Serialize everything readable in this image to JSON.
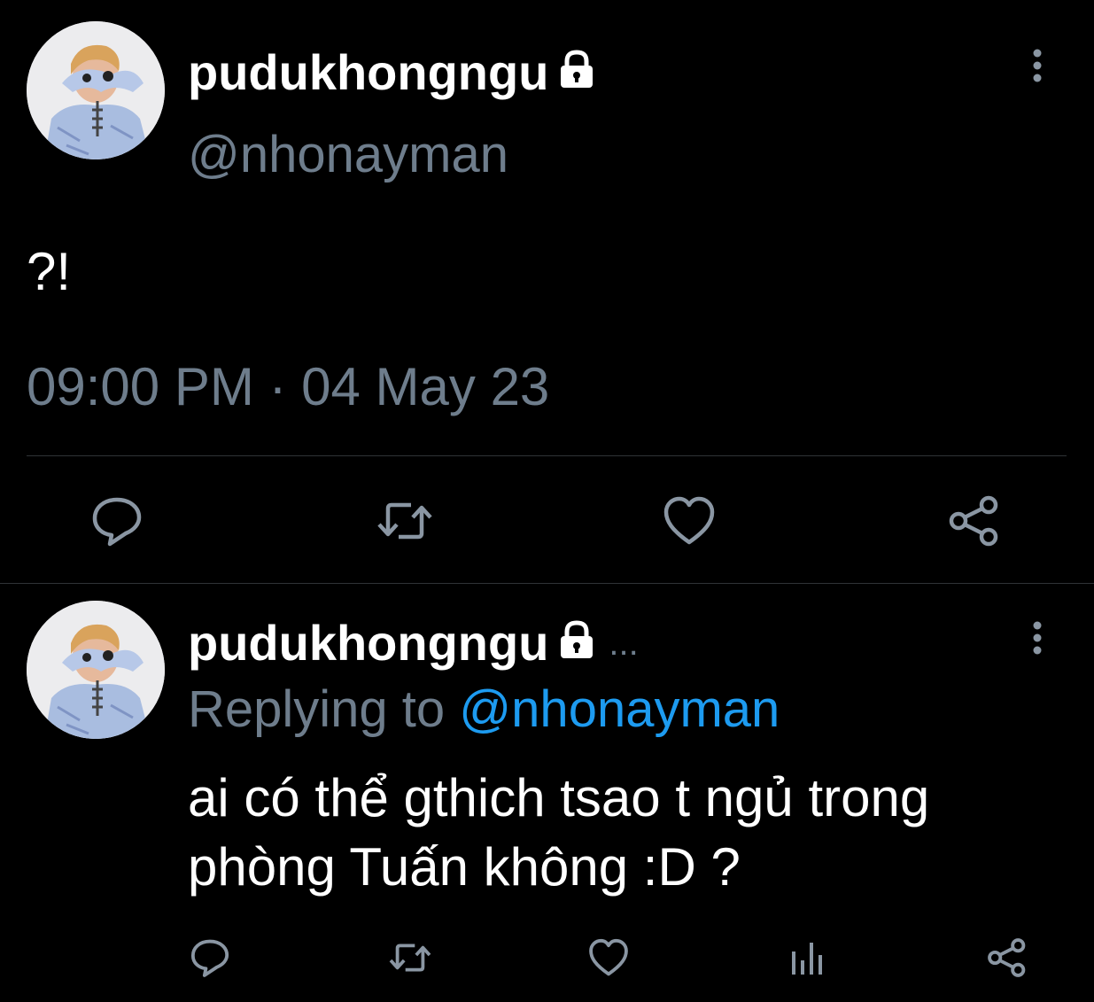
{
  "main_tweet": {
    "display_name": "pudukhongngu",
    "handle": "@nhonayman",
    "text": "?!",
    "timestamp": "09:00 PM · 04 May 23",
    "actions": [
      "reply-icon",
      "retweet-icon",
      "like-icon",
      "share-icon"
    ]
  },
  "reply_tweet": {
    "display_name": "pudukhongngu",
    "ellipsis": "...",
    "replying_prefix": "Replying to",
    "replying_handle": "@nhonayman",
    "text_line1": "ai có thể gthich tsao t ngủ trong",
    "text_line2": "phòng Tuấn không :D ?",
    "actions": [
      "reply-icon",
      "retweet-icon",
      "like-icon",
      "analytics-icon",
      "share-icon"
    ]
  },
  "colors": {
    "background": "#000000",
    "text": "#ffffff",
    "secondary": "#6e7d8c",
    "link": "#1d9bf0",
    "divider": "#2f3336"
  }
}
